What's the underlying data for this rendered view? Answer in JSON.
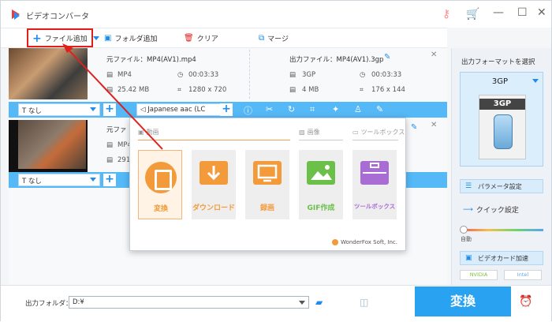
{
  "window": {
    "title": "ビデオコンバータ"
  },
  "toolbar": {
    "add_file": "ファイル追加",
    "add_folder": "フォルダ追加",
    "clear": "クリア",
    "merge": "マージ"
  },
  "file1": {
    "src_label": "元ファイル：MP4(AV1).mp4",
    "src_format": "MP4",
    "src_duration": "00:03:33",
    "src_size": "25.42 MB",
    "src_resolution": "1280 x 720",
    "out_label": "出力ファイル：MP4(AV1).3gp",
    "out_format": "3GP",
    "out_duration": "00:03:33",
    "out_size": "4 MB",
    "out_resolution": "176 x 144",
    "subtitle": "なし",
    "audio": "Japanese aac (LC"
  },
  "file2": {
    "src_label": "元ファ",
    "src_format": "MP4",
    "src_size": "291",
    "subtitle": "なし"
  },
  "popup": {
    "cat_video": "動画",
    "cat_image": "画像",
    "cat_toolbox": "ツールボックス",
    "tiles": [
      "変換",
      "ダウンロード",
      "録画",
      "GIF作成",
      "ツールボックス"
    ],
    "brand": "WonderFox Soft, Inc."
  },
  "right_panel": {
    "title": "出力フォーマットを選択",
    "format": "3GP",
    "format_badge": "3GP",
    "params": "パラメータ設定",
    "quick": "クイック設定",
    "auto": "自動",
    "gpu": "ビデオカード加速",
    "nvidia": "NVIDIA",
    "intel": "Intel"
  },
  "bottom": {
    "out_folder_label": "出力フォルダ：",
    "out_folder_value": "D:¥",
    "convert": "変換"
  },
  "colors": {
    "accent": "#2aa2f2",
    "highlight": "#e0201d",
    "orange": "#f39b3a"
  }
}
